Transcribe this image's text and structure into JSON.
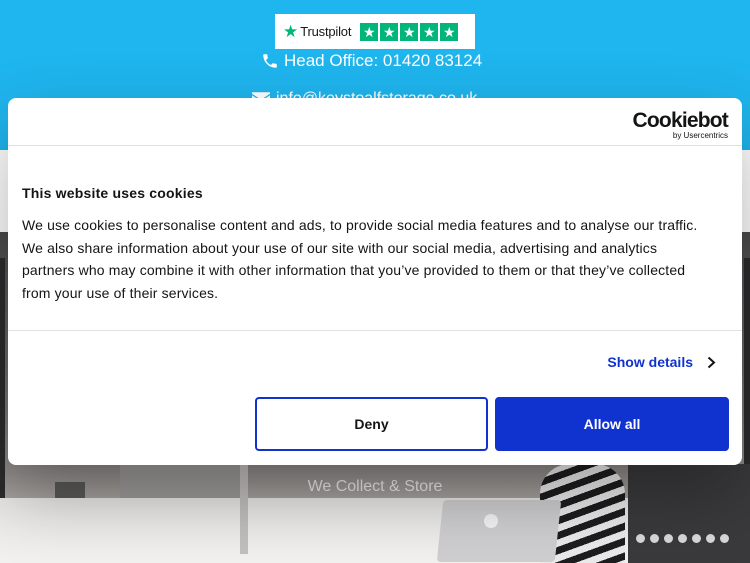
{
  "site": {
    "trustpilot": {
      "wordmark": "Trustpilot",
      "rating_stars": 5,
      "brand_color": "#00b67a"
    },
    "head_office_text": "Head Office: 01420 83124",
    "email_text": "info@keystoalfstorage.co.uk",
    "hero": {
      "caption": "We Collect & Store"
    },
    "header_color": "#1fb5ee"
  },
  "cookie_dialog": {
    "logo": {
      "main": "Cookiebot",
      "sub": "by Usercentrics"
    },
    "title": "This website uses cookies",
    "paragraph_lines": [
      "We use cookies to personalise content and ads, to provide social media features and to analyse our traffic.",
      "We also share information about your use of our site with our social media, advertising and analytics",
      "partners who may combine it with other information that you’ve provided to them or that they’ve collected",
      "from your use of their services."
    ],
    "show_details_label": "Show details",
    "deny_label": "Deny",
    "allow_all_label": "Allow all",
    "accent_color": "#1032cf"
  }
}
